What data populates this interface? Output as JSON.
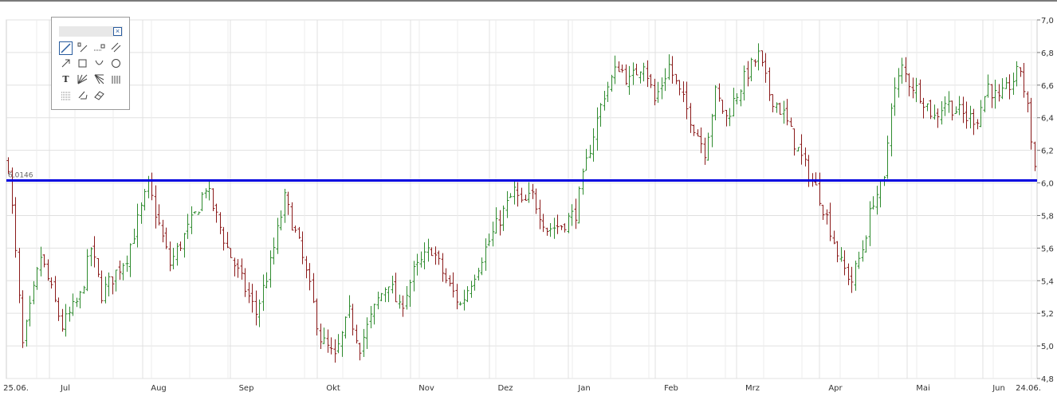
{
  "colors": {
    "up": "#2e8b2e",
    "down": "#8b1a1a",
    "level_line": "#0000e0",
    "grid": "#e0e0e0",
    "accent": "#2a5d9f"
  },
  "chart_data": {
    "type": "ohlc",
    "ylim": [
      4.8,
      7.0
    ],
    "y_ticks": [
      "7,0",
      "6,8",
      "6,6",
      "6,4",
      "6,2",
      "6,0",
      "5,8",
      "5,6",
      "5,4",
      "5,2",
      "5,0",
      "4,8"
    ],
    "x_ticks": [
      "25.06.",
      "Jul",
      "Aug",
      "Sep",
      "Okt",
      "Nov",
      "Dez",
      "Jan",
      "Feb",
      "Mrz",
      "Apr",
      "Mai",
      "Jun",
      "24.06."
    ],
    "horizontal_line": {
      "value": 6.0146,
      "label": "6,0146"
    },
    "grid": true,
    "price_path": [
      [
        0,
        6.12
      ],
      [
        4,
        5.0
      ],
      [
        9,
        5.55
      ],
      [
        15,
        5.12
      ],
      [
        20,
        5.3
      ],
      [
        23,
        5.6
      ],
      [
        26,
        5.32
      ],
      [
        33,
        5.55
      ],
      [
        39,
        5.98
      ],
      [
        45,
        5.5
      ],
      [
        52,
        5.8
      ],
      [
        55,
        5.98
      ],
      [
        61,
        5.6
      ],
      [
        66,
        5.35
      ],
      [
        69,
        5.2
      ],
      [
        73,
        5.5
      ],
      [
        77,
        5.9
      ],
      [
        81,
        5.62
      ],
      [
        84,
        5.35
      ],
      [
        87,
        5.05
      ],
      [
        91,
        4.92
      ],
      [
        95,
        5.2
      ],
      [
        98,
        5.0
      ],
      [
        103,
        5.28
      ],
      [
        106,
        5.4
      ],
      [
        109,
        5.22
      ],
      [
        113,
        5.45
      ],
      [
        118,
        5.6
      ],
      [
        122,
        5.4
      ],
      [
        126,
        5.25
      ],
      [
        132,
        5.55
      ],
      [
        137,
        5.78
      ],
      [
        141,
        5.95
      ],
      [
        143,
        5.86
      ],
      [
        146,
        5.92
      ],
      [
        150,
        5.72
      ],
      [
        154,
        5.74
      ],
      [
        158,
        5.82
      ],
      [
        162,
        6.22
      ],
      [
        166,
        6.55
      ],
      [
        170,
        6.72
      ],
      [
        173,
        6.62
      ],
      [
        177,
        6.75
      ],
      [
        180,
        6.5
      ],
      [
        184,
        6.72
      ],
      [
        187,
        6.55
      ],
      [
        190,
        6.4
      ],
      [
        194,
        6.2
      ],
      [
        197,
        6.55
      ],
      [
        200,
        6.4
      ],
      [
        203,
        6.55
      ],
      [
        206,
        6.68
      ],
      [
        209,
        6.78
      ],
      [
        212,
        6.55
      ],
      [
        216,
        6.42
      ],
      [
        219,
        6.25
      ],
      [
        222,
        6.1
      ],
      [
        226,
        5.92
      ],
      [
        229,
        5.72
      ],
      [
        232,
        5.5
      ],
      [
        235,
        5.4
      ],
      [
        238,
        5.6
      ],
      [
        241,
        5.9
      ],
      [
        244,
        6.0
      ],
      [
        246,
        6.5
      ],
      [
        249,
        6.7
      ],
      [
        251,
        6.62
      ],
      [
        254,
        6.55
      ],
      [
        258,
        6.4
      ],
      [
        261,
        6.5
      ],
      [
        264,
        6.45
      ],
      [
        267,
        6.4
      ],
      [
        270,
        6.4
      ],
      [
        273,
        6.6
      ],
      [
        276,
        6.5
      ],
      [
        279,
        6.6
      ],
      [
        282,
        6.7
      ],
      [
        284,
        6.45
      ],
      [
        286,
        6.1
      ]
    ]
  }
}
